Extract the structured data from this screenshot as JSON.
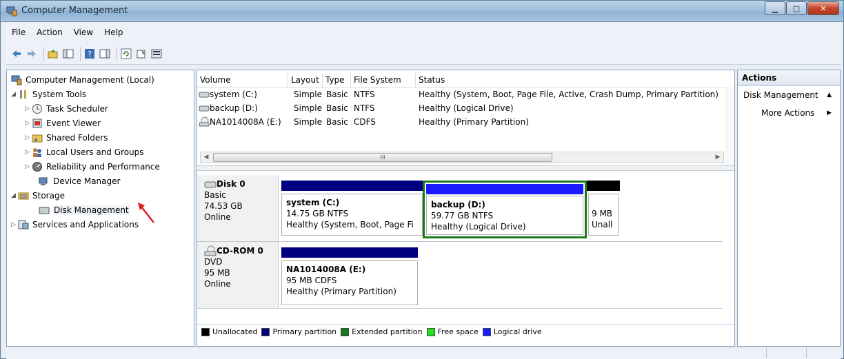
{
  "window": {
    "title": "Computer Management"
  },
  "menu": [
    "File",
    "Action",
    "View",
    "Help"
  ],
  "tree": {
    "root": "Computer Management (Local)",
    "system_tools": "System Tools",
    "task_scheduler": "Task Scheduler",
    "event_viewer": "Event Viewer",
    "shared_folders": "Shared Folders",
    "local_users": "Local Users and Groups",
    "reliability": "Reliability and Performance",
    "device_manager": "Device Manager",
    "storage": "Storage",
    "disk_management": "Disk Management",
    "services": "Services and Applications"
  },
  "volumes": {
    "headers": {
      "volume": "Volume",
      "layout": "Layout",
      "type": "Type",
      "fs": "File System",
      "status": "Status"
    },
    "rows": [
      {
        "volume": "system (C:)",
        "layout": "Simple",
        "type": "Basic",
        "fs": "NTFS",
        "status": "Healthy (System, Boot, Page File, Active, Crash Dump, Primary Partition)"
      },
      {
        "volume": "backup (D:)",
        "layout": "Simple",
        "type": "Basic",
        "fs": "NTFS",
        "status": "Healthy (Logical Drive)"
      },
      {
        "volume": "NA1014008A (E:)",
        "layout": "Simple",
        "type": "Basic",
        "fs": "CDFS",
        "status": "Healthy (Primary Partition)"
      }
    ],
    "scroll_thumb": "III"
  },
  "disks": {
    "disk0": {
      "name": "Disk 0",
      "kind": "Basic",
      "size": "74.53 GB",
      "state": "Online",
      "p1": {
        "name": "system  (C:)",
        "size": "14.75 GB NTFS",
        "status": "Healthy (System, Boot, Page Fi"
      },
      "p2": {
        "name": "backup  (D:)",
        "size": "59.77 GB NTFS",
        "status": "Healthy (Logical Drive)"
      },
      "p3": {
        "size": "9 MB",
        "status": "Unall"
      }
    },
    "cdrom0": {
      "name": "CD-ROM 0",
      "kind": "DVD",
      "size": "95 MB",
      "state": "Online",
      "p1": {
        "name": "NA1014008A  (E:)",
        "size": "95 MB CDFS",
        "status": "Healthy (Primary Partition)"
      }
    }
  },
  "legend": {
    "unallocated": "Unallocated",
    "primary": "Primary partition",
    "extended": "Extended partition",
    "free": "Free space",
    "logical": "Logical drive"
  },
  "colors": {
    "primary": "#000080",
    "logical": "#1a1aff",
    "extended": "#1a7a1a",
    "free": "#22e022",
    "unallocated": "#000000"
  },
  "actions": {
    "header": "Actions",
    "section": "Disk Management",
    "more": "More Actions"
  }
}
